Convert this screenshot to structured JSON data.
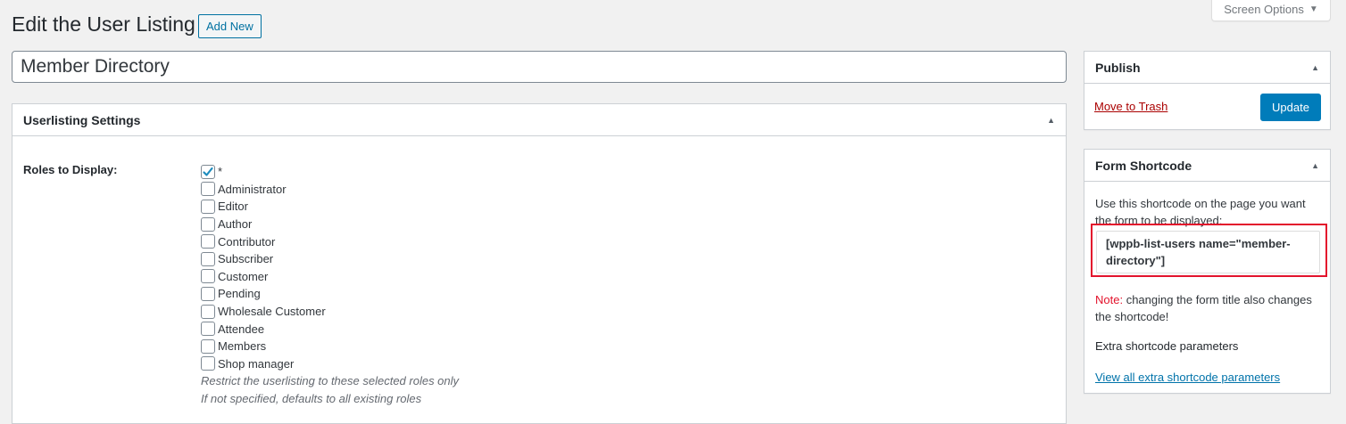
{
  "header": {
    "title": "Edit the User Listing",
    "add_new": "Add New",
    "screen_options": "Screen Options"
  },
  "post_title": "Member Directory",
  "settings_box": {
    "title": "Userlisting Settings",
    "roles_label": "Roles to Display:",
    "roles": [
      {
        "label": "*",
        "checked": true
      },
      {
        "label": "Administrator",
        "checked": false
      },
      {
        "label": "Editor",
        "checked": false
      },
      {
        "label": "Author",
        "checked": false
      },
      {
        "label": "Contributor",
        "checked": false
      },
      {
        "label": "Subscriber",
        "checked": false
      },
      {
        "label": "Customer",
        "checked": false
      },
      {
        "label": "Pending",
        "checked": false
      },
      {
        "label": "Wholesale Customer",
        "checked": false
      },
      {
        "label": "Attendee",
        "checked": false
      },
      {
        "label": "Members",
        "checked": false
      },
      {
        "label": "Shop manager",
        "checked": false
      }
    ],
    "description_1": "Restrict the userlisting to these selected roles only",
    "description_2": "If not specified, defaults to all existing roles"
  },
  "publish_box": {
    "title": "Publish",
    "trash": "Move to Trash",
    "update": "Update"
  },
  "shortcode_box": {
    "title": "Form Shortcode",
    "intro": "Use this shortcode on the page you want the form to be displayed:",
    "shortcode": "[wppb-list-users name=\"member-directory\"]",
    "note_label": "Note:",
    "note_text": " changing the form title also changes the shortcode!",
    "extra_heading": "Extra shortcode parameters",
    "view_all": "View all extra shortcode parameters"
  },
  "colors": {
    "accent": "#007cba",
    "link": "#0073aa",
    "danger": "#a00",
    "highlight": "#e3132c"
  }
}
